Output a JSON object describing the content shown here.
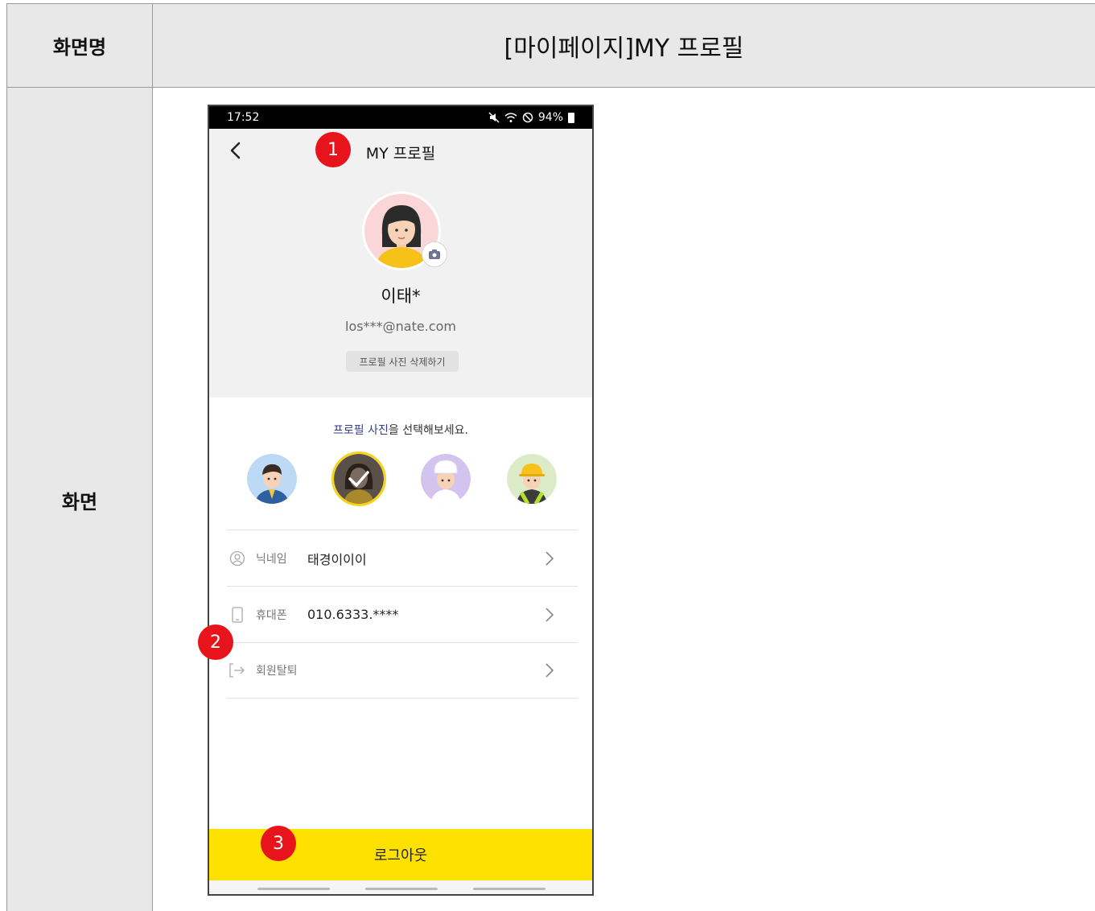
{
  "spec": {
    "header_label": "화면명",
    "screen_title": "[마이페이지]MY 프로필",
    "body_label": "화면"
  },
  "status_bar": {
    "time": "17:52",
    "battery": "94%"
  },
  "header": {
    "title": "MY 프로필"
  },
  "profile": {
    "name": "이태*",
    "email": "los***@nate.com",
    "delete_photo_label": "프로필 사진 삭제하기"
  },
  "avatar_selector": {
    "prompt_highlight": "프로필 사진",
    "prompt_rest": "을 선택해보세요.",
    "selected_index": 1,
    "options": [
      "businessman",
      "woman",
      "chef",
      "construction-worker"
    ]
  },
  "menu": {
    "items": [
      {
        "icon": "person-icon",
        "label": "닉네임",
        "value": "태경이이이"
      },
      {
        "icon": "phone-icon",
        "label": "휴대폰",
        "value": "010.6333.****"
      },
      {
        "icon": "exit-icon",
        "label": "회원탈퇴",
        "value": ""
      }
    ]
  },
  "logout": {
    "label": "로그아웃"
  },
  "markers": [
    "1",
    "2",
    "3"
  ],
  "colors": {
    "accent_yellow": "#ffe100",
    "marker_red": "#e8141b",
    "profile_bg": "#f1f1f1"
  }
}
